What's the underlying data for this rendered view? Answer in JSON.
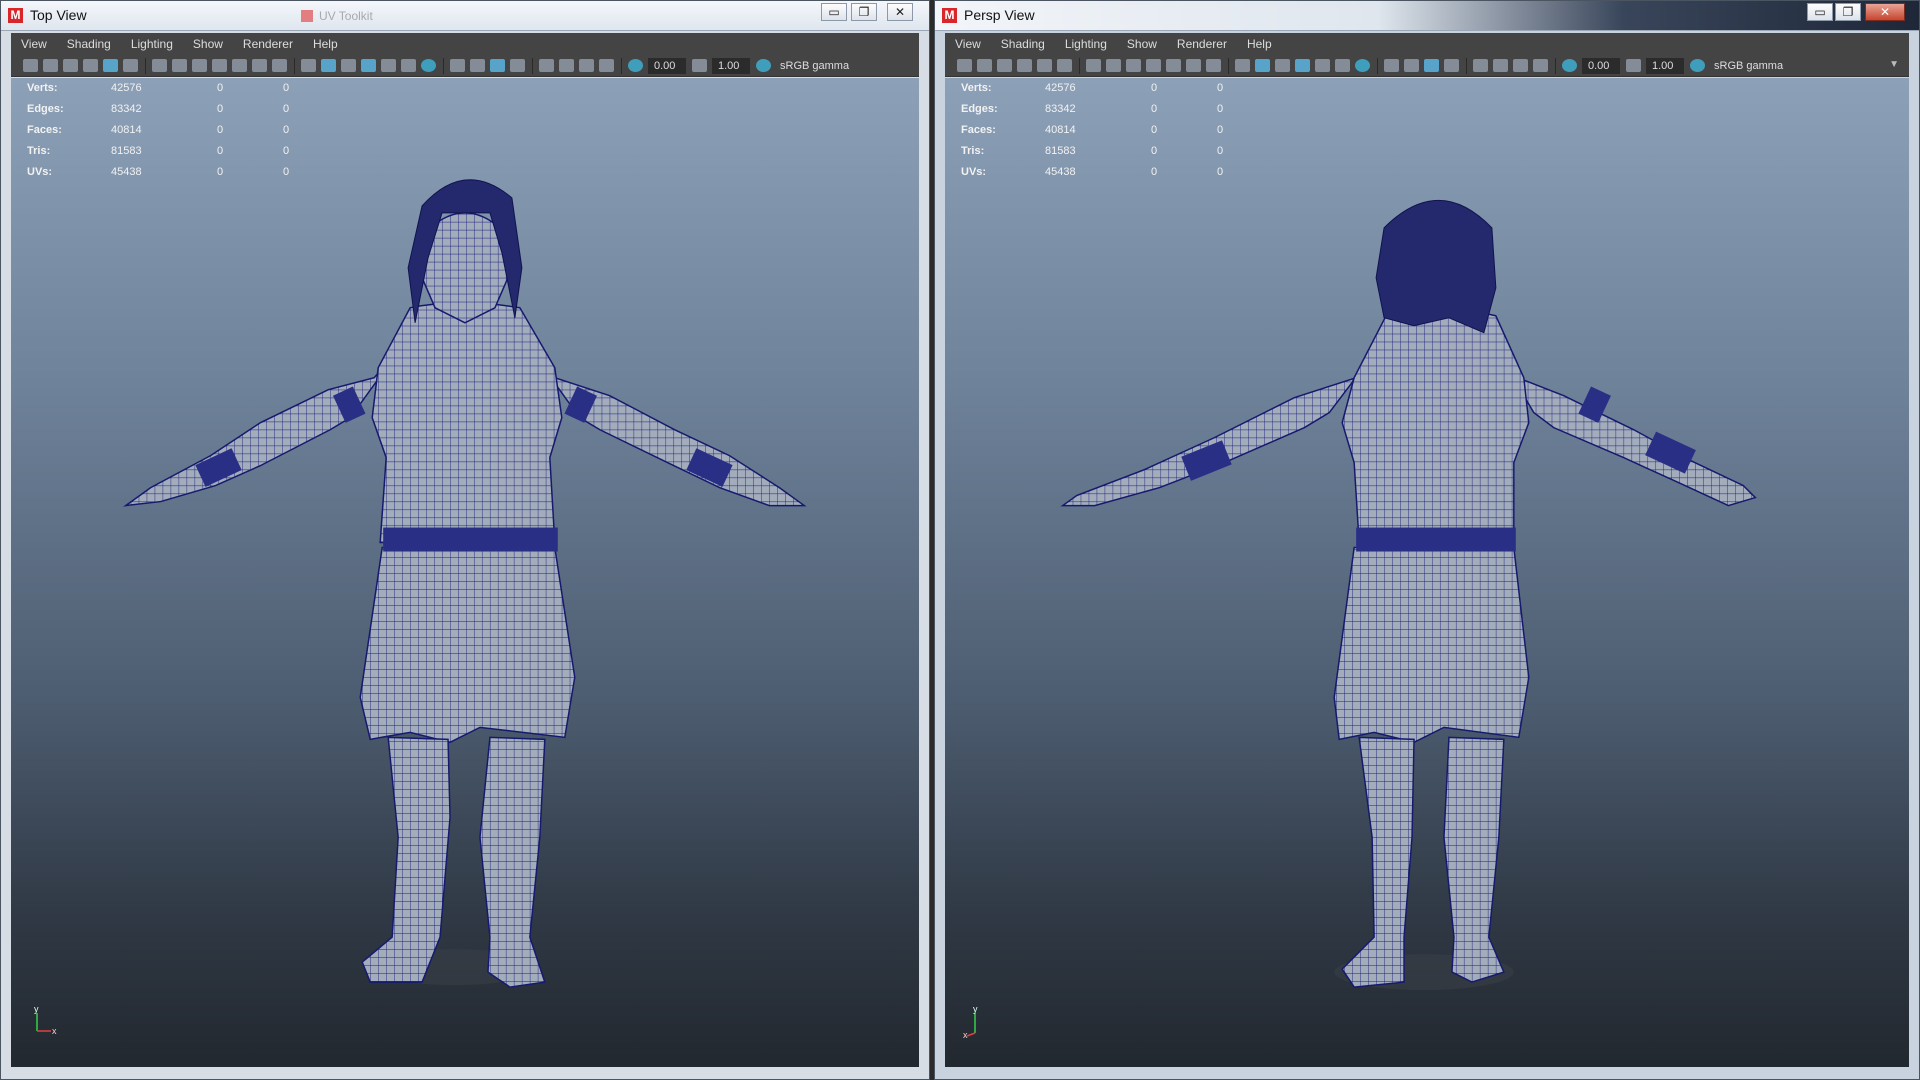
{
  "left_window": {
    "title": "Top View",
    "ghost_title": "UV Toolkit",
    "menu": [
      "View",
      "Shading",
      "Lighting",
      "Show",
      "Renderer",
      "Help"
    ],
    "toolbar": {
      "exposure": "0.00",
      "gamma": "1.00",
      "color_space": "sRGB gamma"
    },
    "stats": [
      {
        "label": "Verts:",
        "v1": "42576",
        "v2": "0",
        "v3": "0"
      },
      {
        "label": "Edges:",
        "v1": "83342",
        "v2": "0",
        "v3": "0"
      },
      {
        "label": "Faces:",
        "v1": "40814",
        "v2": "0",
        "v3": "0"
      },
      {
        "label": "Tris:",
        "v1": "81583",
        "v2": "0",
        "v3": "0"
      },
      {
        "label": "UVs:",
        "v1": "45438",
        "v2": "0",
        "v3": "0"
      }
    ],
    "axis": {
      "y": "y",
      "x": "x"
    }
  },
  "right_window": {
    "title": "Persp View",
    "menu": [
      "View",
      "Shading",
      "Lighting",
      "Show",
      "Renderer",
      "Help"
    ],
    "toolbar": {
      "exposure": "0.00",
      "gamma": "1.00",
      "color_space": "sRGB gamma"
    },
    "stats": [
      {
        "label": "Verts:",
        "v1": "42576",
        "v2": "0",
        "v3": "0"
      },
      {
        "label": "Edges:",
        "v1": "83342",
        "v2": "0",
        "v3": "0"
      },
      {
        "label": "Faces:",
        "v1": "40814",
        "v2": "0",
        "v3": "0"
      },
      {
        "label": "Tris:",
        "v1": "81583",
        "v2": "0",
        "v3": "0"
      },
      {
        "label": "UVs:",
        "v1": "45438",
        "v2": "0",
        "v3": "0"
      }
    ],
    "axis": {
      "y": "y",
      "x": "x"
    }
  },
  "icons": {
    "app_logo": "maya-logo-icon",
    "window_buttons": [
      "minimize-icon",
      "maximize-icon",
      "close-icon"
    ],
    "toolbar": [
      "camera-icon",
      "grid-icon",
      "shading-icon",
      "light-icon",
      "xray-icon",
      "exposure-icon",
      "gamma-icon",
      "colorspace-icon"
    ]
  },
  "colors": {
    "viewport_top": "#8ca0b8",
    "viewport_bottom": "#22282f",
    "wireframe": "#1a1f7a",
    "mesh": "#9ea8b8"
  }
}
